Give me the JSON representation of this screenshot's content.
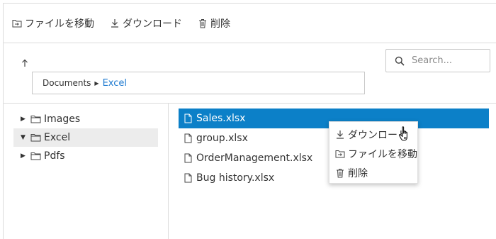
{
  "toolbar": {
    "move_label": "ファイルを移動",
    "download_label": "ダウンロード",
    "delete_label": "削除"
  },
  "breadcrumb": {
    "root": "Documents",
    "current": "Excel"
  },
  "search": {
    "placeholder": "Search..."
  },
  "tree": {
    "items": [
      {
        "label": "Images",
        "expanded": false,
        "selected": false
      },
      {
        "label": "Excel",
        "expanded": true,
        "selected": true
      },
      {
        "label": "Pdfs",
        "expanded": false,
        "selected": false
      }
    ]
  },
  "files": {
    "rows": [
      {
        "name": "Sales.xlsx",
        "selected": true
      },
      {
        "name": "group.xlsx",
        "selected": false
      },
      {
        "name": "OrderManagement.xlsx",
        "selected": false
      },
      {
        "name": "Bug history.xlsx",
        "selected": false
      }
    ]
  },
  "context_menu": {
    "download_label": "ダウンロード",
    "move_label": "ファイルを移動",
    "delete_label": "削除"
  },
  "colors": {
    "accent": "#0c80c8",
    "link": "#1e7ad0",
    "selected_tree": "#ececec"
  },
  "icons": [
    "move-file-icon",
    "download-icon",
    "trash-icon",
    "up-arrow-icon",
    "search-icon",
    "folder-icon",
    "file-icon",
    "hand-cursor-icon"
  ]
}
